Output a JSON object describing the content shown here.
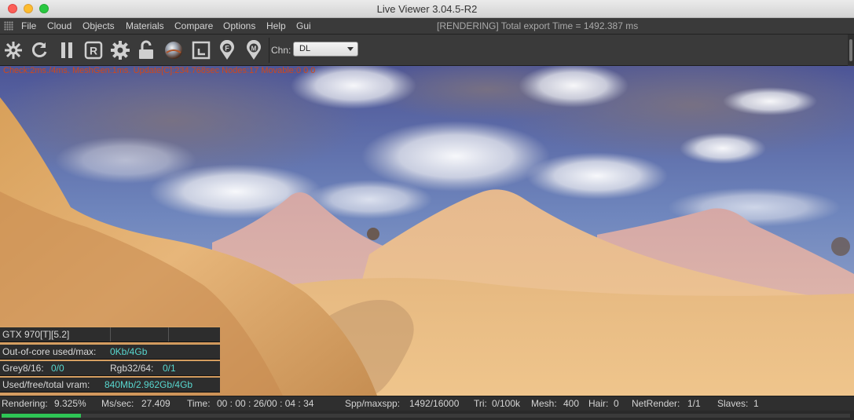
{
  "window": {
    "title": "Live Viewer 3.04.5-R2"
  },
  "menu": {
    "items": [
      "File",
      "Cloud",
      "Objects",
      "Materials",
      "Compare",
      "Options",
      "Help",
      "Gui"
    ],
    "status_message": "[RENDERING] Total export Time = 1492.387 ms"
  },
  "toolbar": {
    "icons": [
      "aperture-icon",
      "refresh-icon",
      "pause-icon",
      "render-region-icon",
      "gear-icon",
      "unlock-icon",
      "material-ball-icon",
      "crop-region-icon",
      "focus-pin-icon",
      "material-pin-icon"
    ],
    "channel_label": "Chn:",
    "channel_value": "DL"
  },
  "viewport": {
    "overlay_text": "Check:2ms./4ms. MeshGen:1ms. Update[C]:234.768sec Nodes:17 Movable:0  0 0"
  },
  "hud": {
    "gpu": "GTX 970[T][5.2]",
    "out_of_core_label": "Out-of-core used/max:",
    "out_of_core_value": "0Kb/4Gb",
    "grey_label": "Grey8/16:",
    "grey_value": "0/0",
    "rgb_label": "Rgb32/64:",
    "rgb_value": "0/1",
    "vram_label": "Used/free/total vram:",
    "vram_value": "840Mb/2.962Gb/4Gb"
  },
  "status": {
    "rendering_label": "Rendering:",
    "rendering_value": "9.325%",
    "ms_label": "Ms/sec:",
    "ms_value": "27.409",
    "time_label": "Time:",
    "time_value": "00 : 00 : 26/00 : 04 : 34",
    "spp_label": "Spp/maxspp:",
    "spp_value": "1492/16000",
    "tri_label": "Tri:",
    "tri_value": "0/100k",
    "mesh_label": "Mesh:",
    "mesh_value": "400",
    "hair_label": "Hair:",
    "hair_value": "0",
    "netrender_label": "NetRender:",
    "netrender_value": "1/1",
    "slaves_label": "Slaves:",
    "slaves_value": "1"
  },
  "progress": {
    "fraction": 0.09325
  },
  "colors": {
    "accent_cyan": "#58d7cf",
    "progress_green": "#2ec455",
    "overlay_orange": "#d0481a"
  }
}
